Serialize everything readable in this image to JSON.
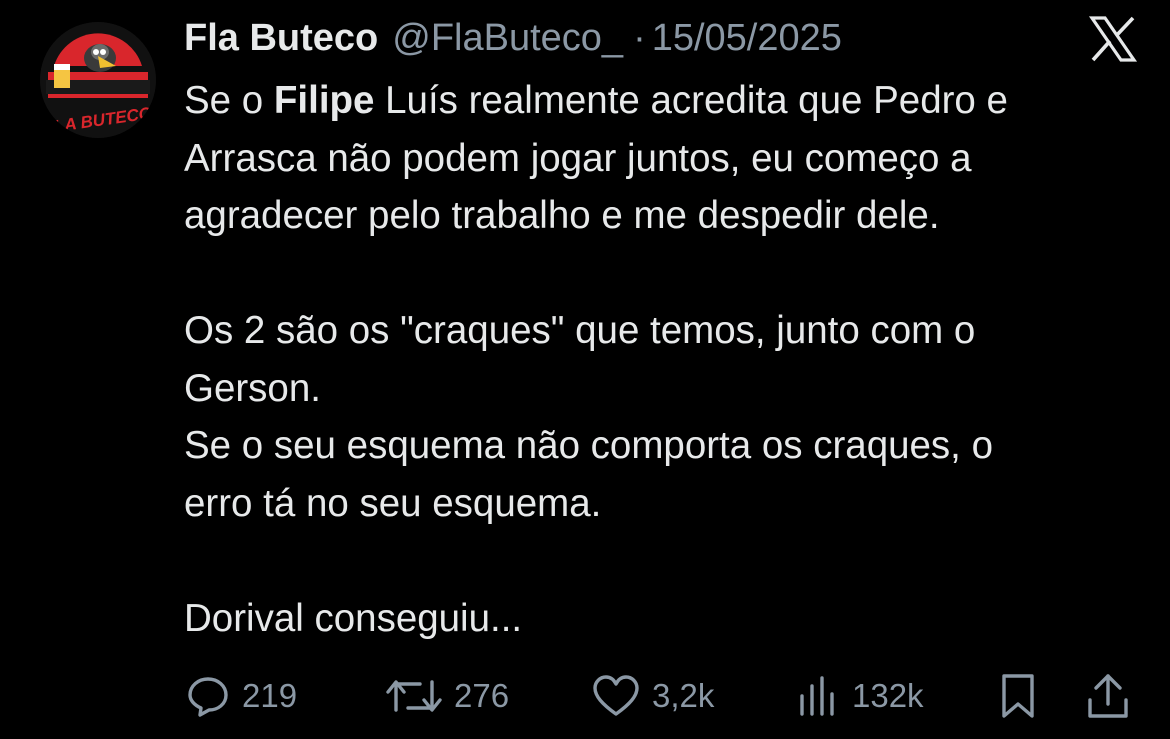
{
  "tweet": {
    "author": {
      "name": "Fla Buteco",
      "handle": "@FlaButeco_",
      "avatar_text": "FLA BUTECO",
      "avatar_colors": {
        "red": "#d9262c",
        "dark": "#1a1a1a"
      }
    },
    "separator": "·",
    "date": "15/05/2025",
    "body": {
      "line1_pre": "Se o ",
      "line1_bold": "Filipe",
      "line1_post": " Luís realmente acredita que Pedro e",
      "line2": "Arrasca não podem jogar juntos, eu começo a",
      "line3": "agradecer pelo trabalho e me despedir dele.",
      "line4": "Os 2 são os \"craques\" que temos, junto com o",
      "line5": "Gerson.",
      "line6": "Se o seu esquema não comporta os craques, o",
      "line7": "erro tá no seu esquema.",
      "line8": "Dorival conseguiu..."
    },
    "metrics": {
      "replies": "219",
      "reposts": "276",
      "likes": "3,2k",
      "views": "132k"
    }
  },
  "icons": {
    "platform": "x-logo-icon",
    "reply": "reply-icon",
    "repost": "repost-icon",
    "like": "heart-icon",
    "views": "views-icon",
    "bookmark": "bookmark-icon",
    "share": "share-icon"
  },
  "colors": {
    "background": "#000000",
    "text": "#e7e9ea",
    "secondary": "#8b98a5"
  }
}
